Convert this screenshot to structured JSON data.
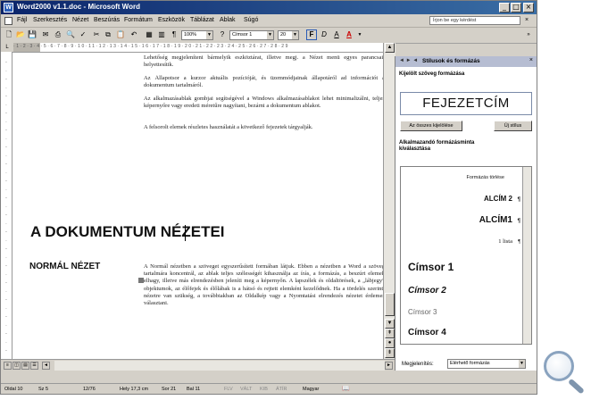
{
  "window": {
    "title": "Word2000 v1.1.doc - Microsoft Word",
    "app_icon": "W",
    "controls": [
      "_",
      "□",
      "×"
    ]
  },
  "menu": {
    "items": [
      "Fájl",
      "Szerkesztés",
      "Nézet",
      "Beszúrás",
      "Formátum",
      "Eszközök",
      "Táblázat",
      "Ablak",
      "Súgó"
    ],
    "help_placeholder": "Írjon be egy kérdést",
    "doc_close": "×"
  },
  "toolbar": {
    "zoom": "100%",
    "style_box": "Címsor 1",
    "font_size": "20",
    "icons": [
      "new-icon",
      "open-icon",
      "save-icon",
      "permission-icon",
      "email-icon",
      "print-icon",
      "preview-icon",
      "spelling-icon",
      "cut-icon",
      "copy-icon",
      "paste-icon",
      "undo-icon",
      "table-icon",
      "columns-icon",
      "paragraph-icon",
      "bold-icon",
      "italic-icon",
      "underline-icon",
      "font-color-icon"
    ]
  },
  "document": {
    "para1": "Lehetőség megjeleníteni bármelyik eszköztárat, illetve megj. a Nézet menü egyes parancsait helyettesítik.",
    "para2": "Az Állapotsor a kurzor aktuális pozícióját, és üzemmódjainak állapotáról ad információt a dokumentum tartalmáról.",
    "para3": "Az alkalmazásablak gombjai segítségével a Windows alkalmazásablakot lehet minimalizálni, teljes képernyőre vagy eredeti méretűre nagyítani, bezárni a dokumentum ablakot.",
    "para4": "A felsorolt elemek részletes használatát a következő fejezetek tárgyalják.",
    "heading1": "A DOKUMENTUM NÉZETEI",
    "heading2": "NORMÁL NÉZET",
    "para5": "A Normál nézetben a szöveget egyszerűsített formában látjuk. Ebben a nézetben a Word a szöveg tartalmára koncentrál, az ablak teljes szélességét kihasználja az írás, a formázás, a beszúrt elemek elhagy, illetve más elrendezésben jeleníti meg a képernyőn. A lapszélek és oldaltörések, a „lábjegy” objektumok, az élőfejek és élőlábak is a hátsó és rejtett elemként kezelődnek. Ha a tördelés szerinti nézetre van szükség, a továbbiakban az Oldalkép vagy a Nyomtatási elrendezés nézetet érdemes választani."
  },
  "task_pane": {
    "title": "Stílusok és formázás",
    "nav": "◄ ► ◄",
    "close": "×",
    "selected_label": "Kijelölt szöveg formázása",
    "selected_style": "FEJEZETCÍM",
    "btn_select_all": "Az összes kijelölése",
    "btn_new": "Új stílus",
    "apply_label": "Alkalmazandó formázásminta kiválasztása",
    "styles": [
      {
        "label": "Formázás törlése",
        "mark": ""
      },
      {
        "label": "ALCÍM 2",
        "mark": "¶"
      },
      {
        "label": "ALCÍM1",
        "mark": "¶"
      },
      {
        "label": "1 lista",
        "mark": "¶"
      },
      {
        "label": "Címsor 1",
        "mark": "¶"
      },
      {
        "label": "Címsor 2",
        "mark": "¶"
      },
      {
        "label": "Címsor 3",
        "mark": "¶"
      },
      {
        "label": "Címsor 4",
        "mark": "¶"
      }
    ],
    "show_label": "Megjelenítés:",
    "show_value": "Elérhető formázás"
  },
  "statusbar": {
    "page": "Oldal 10",
    "section": "Sz 5",
    "pages": "12/76",
    "position": "Hely 17,3 cm",
    "line": "Sor 21",
    "column": "Bal 11",
    "rec": "FLV",
    "trk": "VÁLT",
    "ext": "KIB",
    "ovr": "ÁTÍR",
    "lang": "Magyar"
  }
}
